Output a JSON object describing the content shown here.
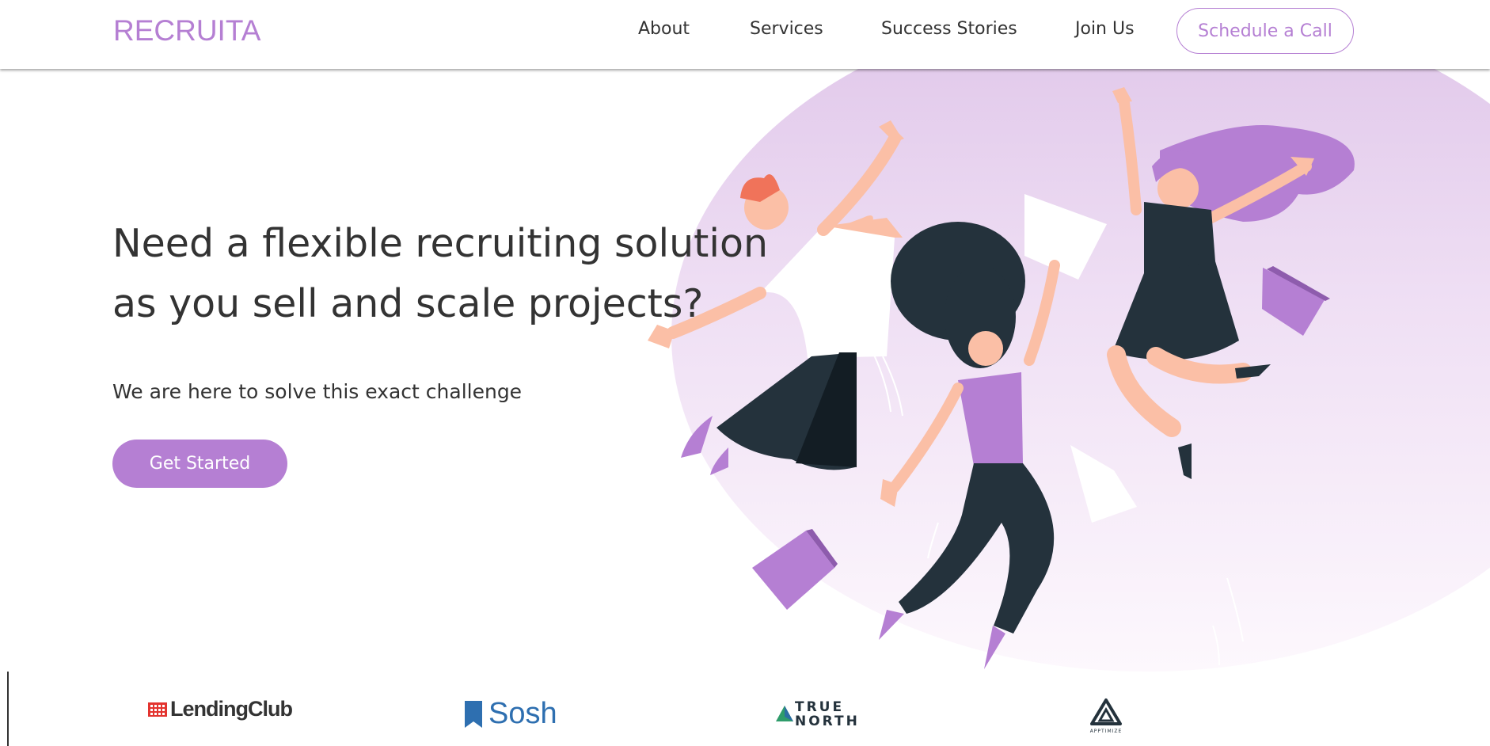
{
  "header": {
    "logo": "RECRUITA",
    "nav": [
      {
        "label": "About"
      },
      {
        "label": "Services"
      },
      {
        "label": "Success Stories"
      },
      {
        "label": "Join Us"
      }
    ],
    "cta_label": "Schedule a Call"
  },
  "hero": {
    "title_line1": "Need a flexible recruiting solution",
    "title_line2": "as you sell and scale projects?",
    "subtitle": "We are here to solve this exact challenge",
    "button_label": "Get Started"
  },
  "clients": [
    {
      "name": "LendingClub",
      "icon": "lendingclub-logo"
    },
    {
      "name": "Sosh",
      "icon": "sosh-logo"
    },
    {
      "name": "TRUE NORTH",
      "icon": "true-north-logo"
    },
    {
      "name": "APPTIMIZE",
      "icon": "apptimize-logo"
    }
  ],
  "colors": {
    "accent": "#b57fd3",
    "text": "#333333",
    "dark": "#24323c",
    "skin": "#fbbfa6",
    "hair_red": "#f0735a"
  }
}
